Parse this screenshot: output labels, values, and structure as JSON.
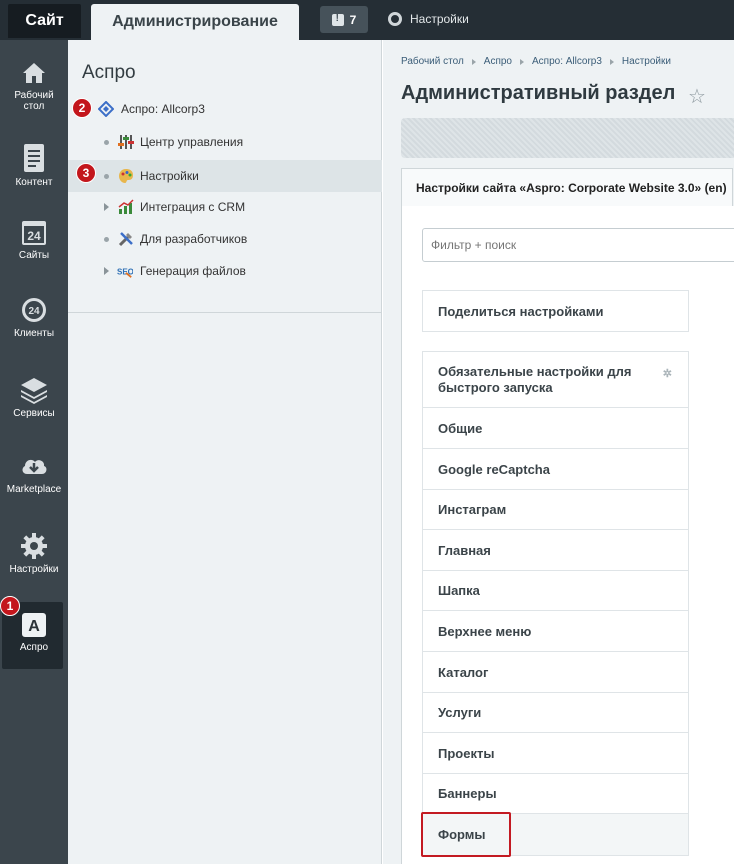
{
  "topbar": {
    "site_tab": "Сайт",
    "admin_tab": "Администрирование",
    "notifications_count": "7",
    "settings_label": "Настройки"
  },
  "leftbar": {
    "items": [
      {
        "label_line1": "Рабочий",
        "label_line2": "стол",
        "icon": "home-icon"
      },
      {
        "label_line1": "Контент",
        "label_line2": "",
        "icon": "document-icon"
      },
      {
        "label_line1": "Сайты",
        "label_line2": "",
        "icon": "calendar-24-icon"
      },
      {
        "label_line1": "Клиенты",
        "label_line2": "",
        "icon": "clients-24-icon"
      },
      {
        "label_line1": "Сервисы",
        "label_line2": "",
        "icon": "layers-icon"
      },
      {
        "label_line1": "Marketplace",
        "label_line2": "",
        "icon": "cloud-download-icon"
      },
      {
        "label_line1": "Настройки",
        "label_line2": "",
        "icon": "gear-icon"
      },
      {
        "label_line1": "Аспро",
        "label_line2": "",
        "icon": "aspro-icon"
      }
    ],
    "badge_1": "1"
  },
  "midpanel": {
    "title": "Аспро",
    "badge_2": "2",
    "badge_3": "3",
    "tree": [
      {
        "label": "Аспро: Allcorp3",
        "icon": "diamond-icon"
      },
      {
        "label": "Центр управления",
        "icon": "sliders-icon"
      },
      {
        "label": "Настройки",
        "icon": "palette-icon"
      },
      {
        "label": "Интеграция с CRM",
        "icon": "chart-icon"
      },
      {
        "label": "Для разработчиков",
        "icon": "tools-icon"
      },
      {
        "label": "Генерация файлов",
        "icon": "seo-icon"
      }
    ]
  },
  "content": {
    "breadcrumb": [
      "Рабочий стол",
      "Аспро",
      "Аспро: Allcorp3",
      "Настройки"
    ],
    "page_title": "Административный раздел",
    "section_tab": "Настройки сайта «Aspro: Corporate Website 3.0» (en)",
    "filter_placeholder": "Фильтр + поиск",
    "share_label": "Поделиться настройками",
    "menu": [
      "Обязательные настройки для быстрого запуска",
      "Общие",
      "Google reCaptcha",
      "Инстаграм",
      "Главная",
      "Шапка",
      "Верхнее меню",
      "Каталог",
      "Услуги",
      "Проекты",
      "Баннеры",
      "Формы"
    ]
  },
  "colors": {
    "topbar_bg": "#252e35",
    "sidebar_bg": "#3b454c",
    "panel_bg": "#eef2f4",
    "badge_red": "#c3161c",
    "highlight_red": "#c31a22"
  }
}
